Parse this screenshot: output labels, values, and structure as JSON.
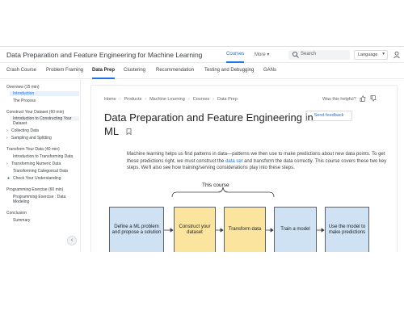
{
  "header": {
    "site_title": "Data Preparation and Feature Engineering for Machine Learning",
    "tabs": [
      {
        "label": "Courses"
      },
      {
        "label": "More"
      }
    ],
    "search_placeholder": "Search",
    "language": "Language"
  },
  "subnav": {
    "tabs": [
      "Crash Course",
      "Problem Framing",
      "Data Prep",
      "Clustering",
      "Recommendation",
      "Testing and Debugging",
      "GANs"
    ],
    "active": "Data Prep"
  },
  "sidebar": {
    "overview": "Overview (15 min)",
    "introduction": "Introduction",
    "process": "The Process",
    "construct_header": "Construct Your Dataset (60 min)",
    "construct_intro": "Introduction to Constructing Your",
    "construct_intro_2": "Dataset",
    "collecting": "Collecting Data",
    "sampling": "Sampling and Splitting",
    "transform_header": "Transform Your Data (40 min)",
    "transform_intro": "Introduction to Transforming Data",
    "transform_numeric": "Transforming Numeric Data",
    "transform_categorical": "Transforming Categorical Data",
    "check": "Check Your Understanding",
    "programming_header": "Programming Exercise (60 min)",
    "programming_item": "Programming Exercise : Data",
    "programming_item_2": "Modeling",
    "conclusion": "Conclusion",
    "summary": "Summary"
  },
  "main": {
    "breadcrumb": [
      "Home",
      "Products",
      "Machine Learning",
      "Courses",
      "Data Prep"
    ],
    "helpful": "Was this helpful?",
    "title_line1": "Data Preparation and Feature Engineering in",
    "title_line2": "ML",
    "feedback": "Send feedback",
    "para_before": "Machine learning helps us find patterns in data—patterns we then use to make predictions about new data points. To get those predictions right, we must construct the ",
    "para_link": "data set",
    "para_after": " and transform the data correctly. This course covers these two key steps. We'll also see how training/serving considerations play into these steps."
  },
  "diagram": {
    "course_label": "This course",
    "steps": [
      {
        "label": "Define a ML problem and propose a solution",
        "color": "#cfe2f3"
      },
      {
        "label": "Construct your dataset",
        "color": "#fbe59e"
      },
      {
        "label": "Transform data",
        "color": "#fbe59e"
      },
      {
        "label": "Train a model",
        "color": "#cfe2f3"
      },
      {
        "label": "Use the model to make predictions",
        "color": "#cfe2f3"
      }
    ]
  },
  "colors": {
    "accent": "#1a73e8",
    "highlight_bg": "#e8f0fe",
    "box_blue": "#cfe2f3",
    "box_yellow": "#fbe59e"
  },
  "icons": [
    "search-icon",
    "account-icon",
    "thumb-up-icon",
    "thumb-down-icon",
    "bookmark-icon",
    "check-circle-icon",
    "chevron-left-icon"
  ]
}
